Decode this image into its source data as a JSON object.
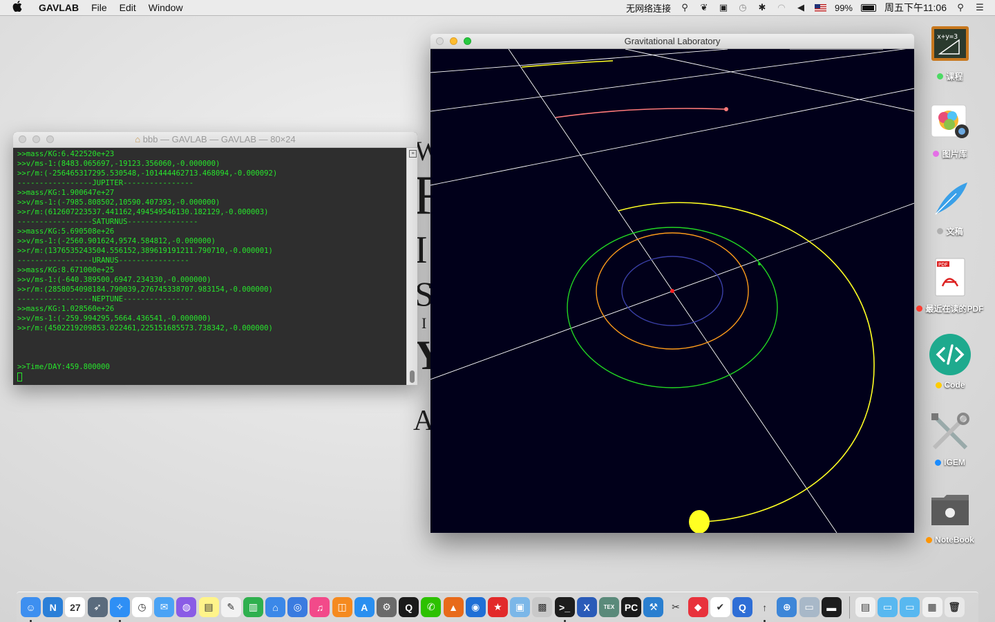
{
  "menubar": {
    "apple": "",
    "app_name": "GAVLAB",
    "menus": [
      "File",
      "Edit",
      "Window"
    ],
    "network": "无网络连接",
    "battery": "99%",
    "clock": "周五下午11:06"
  },
  "background_doc": {
    "fragments": [
      "W",
      "R",
      "I",
      "S",
      "I",
      "Y",
      "A"
    ]
  },
  "terminal": {
    "title": "bbb — GAVLAB — GAVLAB — 80×24",
    "lines": [
      ">>mass/KG:6.422520e+23",
      ">>v/ms-1:(8483.065697,-19123.356060,-0.000000)",
      ">>r/m:(-256465317295.530548,-101444462713.468094,-0.000092)",
      "-----------------JUPITER----------------",
      ">>mass/KG:1.900647e+27",
      ">>v/ms-1:(-7985.808502,10590.407393,-0.000000)",
      ">>r/m:(612607223537.441162,494549546130.182129,-0.000003)",
      "-----------------SATURNUS----------------",
      ">>mass/KG:5.690508e+26",
      ">>v/ms-1:(-2560.901624,9574.584812,-0.000000)",
      ">>r/m:(1376535243504.556152,389619191211.790710,-0.000001)",
      "-----------------URANUS----------------",
      ">>mass/KG:8.671000e+25",
      ">>v/ms-1:(-640.389500,6947.234330,-0.000000)",
      ">>r/m:(2858054098184.790039,276745338707.983154,-0.000000)",
      "-----------------NEPTUNE----------------",
      ">>mass/KG:1.028560e+26",
      ">>v/ms-1:(-259.994295,5664.436541,-0.000000)",
      ">>r/m:(4502219209853.022461,225151685573.738342,-0.000000)",
      "",
      "",
      "",
      ">>Time/DAY:459.800000"
    ]
  },
  "gravlab": {
    "title": "Gravitational Laboratory",
    "orbit_colors": {
      "inner": "#3a3fa6",
      "orange": "#ff9c1a",
      "green": "#22d622",
      "yellow": "#ffff22",
      "pink": "#ff7a7a",
      "grid": "#ffffff",
      "sun": "#ff2020"
    }
  },
  "desktop_icons": [
    {
      "label": "课程",
      "dot": "#4cd964",
      "icon": "blackboard-icon",
      "formula": "x+y=3"
    },
    {
      "label": "图片库",
      "dot": "#e46ee6",
      "icon": "photos-icon"
    },
    {
      "label": "文稿",
      "dot": "#b0b0b0",
      "icon": "quill-icon"
    },
    {
      "label": "最近在读的PDF",
      "dot": "#ff3b30",
      "icon": "pdf-icon",
      "badge": "PDF"
    },
    {
      "label": "Code",
      "dot": "#ffcc00",
      "icon": "code-icon"
    },
    {
      "label": "IGEM",
      "dot": "#1a8cff",
      "icon": "tools-icon"
    },
    {
      "label": "NoteBook",
      "dot": "#ff9500",
      "icon": "folder-icon"
    }
  ],
  "dock": {
    "apps": [
      {
        "name": "finder-icon",
        "bg": "#3d8ff0",
        "glyph": "☺",
        "running": true
      },
      {
        "name": "notes-n-icon",
        "bg": "#2a7fd8",
        "glyph": "N",
        "running": false
      },
      {
        "name": "calendar-icon",
        "bg": "#ffffff",
        "glyph": "27",
        "running": false
      },
      {
        "name": "launchpad-icon",
        "bg": "#5a6b7d",
        "glyph": "➶",
        "running": false
      },
      {
        "name": "safari-icon",
        "bg": "#2e8ff5",
        "glyph": "✧",
        "running": true
      },
      {
        "name": "clock-icon",
        "bg": "#ffffff",
        "glyph": "◷",
        "running": false
      },
      {
        "name": "mail-icon",
        "bg": "#4aa3f5",
        "glyph": "✉",
        "running": false
      },
      {
        "name": "siri-icon",
        "bg": "#8a5ce6",
        "glyph": "◍",
        "running": false
      },
      {
        "name": "stickies-icon",
        "bg": "#fff48a",
        "glyph": "▤",
        "running": false
      },
      {
        "name": "textedit-icon",
        "bg": "#f2f2f2",
        "glyph": "✎",
        "running": false
      },
      {
        "name": "numbers-icon",
        "bg": "#2fb04e",
        "glyph": "▥",
        "running": false
      },
      {
        "name": "keynote-icon",
        "bg": "#3b88e8",
        "glyph": "⌂",
        "running": false
      },
      {
        "name": "network-icon",
        "bg": "#3a7be0",
        "glyph": "◎",
        "running": false
      },
      {
        "name": "itunes-icon",
        "bg": "#f24a8a",
        "glyph": "♫",
        "running": false
      },
      {
        "name": "ibooks-icon",
        "bg": "#f58a1f",
        "glyph": "◫",
        "running": false
      },
      {
        "name": "appstore-icon",
        "bg": "#2a8ff0",
        "glyph": "A",
        "running": false
      },
      {
        "name": "system-preferences-icon",
        "bg": "#6a6a6a",
        "glyph": "⚙",
        "running": false
      },
      {
        "name": "qq-icon",
        "bg": "#1a1a1a",
        "glyph": "Q",
        "running": false
      },
      {
        "name": "wechat-icon",
        "bg": "#2dc100",
        "glyph": "✆",
        "running": false
      },
      {
        "name": "matlab-icon",
        "bg": "#e86a1a",
        "glyph": "▲",
        "running": false
      },
      {
        "name": "sequel-icon",
        "bg": "#1f6fd6",
        "glyph": "◉",
        "running": false
      },
      {
        "name": "bookmark-icon",
        "bg": "#e22a2a",
        "glyph": "★",
        "running": false
      },
      {
        "name": "preview-icon",
        "bg": "#7bb7e8",
        "glyph": "▣",
        "running": false
      },
      {
        "name": "presentation-icon",
        "bg": "#c9c9c9",
        "glyph": "▩",
        "running": false
      },
      {
        "name": "terminal-icon",
        "bg": "#1d1d1d",
        "glyph": ">_",
        "running": true
      },
      {
        "name": "xquartz-icon",
        "bg": "#2a5bb8",
        "glyph": "X",
        "running": false
      },
      {
        "name": "tex-icon",
        "bg": "#5a8a7a",
        "glyph": "TEX",
        "running": false
      },
      {
        "name": "pycharm-icon",
        "bg": "#1a1a1a",
        "glyph": "PC",
        "running": false
      },
      {
        "name": "xcode-icon",
        "bg": "#2a7fd0",
        "glyph": "⚒",
        "running": false
      },
      {
        "name": "utilities-icon",
        "bg": "#d8d8d8",
        "glyph": "✂",
        "running": false
      },
      {
        "name": "pages-red-icon",
        "bg": "#e8323c",
        "glyph": "◆",
        "running": false
      },
      {
        "name": "pocket-icon",
        "bg": "#ffffff",
        "glyph": "✔",
        "running": false
      },
      {
        "name": "quicktime-icon",
        "bg": "#2e6ed6",
        "glyph": "Q",
        "running": false
      },
      {
        "name": "gravlab-icon",
        "bg": "#d8d8d8",
        "glyph": "↑",
        "running": true
      },
      {
        "name": "migration-icon",
        "bg": "#3d86d8",
        "glyph": "⊕",
        "running": false
      },
      {
        "name": "scanner-icon",
        "bg": "#a8b8c8",
        "glyph": "▭",
        "running": false
      },
      {
        "name": "console-icon",
        "bg": "#1d1d1d",
        "glyph": "▬",
        "running": false
      }
    ],
    "stack": [
      {
        "name": "document-stack-icon",
        "bg": "#f0f0f0",
        "glyph": "▤"
      },
      {
        "name": "folder-stack-icon",
        "bg": "#58b8f0",
        "glyph": "▭"
      },
      {
        "name": "downloads-stack-icon",
        "bg": "#58b8f0",
        "glyph": "▭"
      },
      {
        "name": "screenshot-stack-icon",
        "bg": "#f0f0f0",
        "glyph": "▦"
      },
      {
        "name": "trash-icon",
        "bg": "#e8e8e8",
        "glyph": "🗑"
      }
    ]
  }
}
